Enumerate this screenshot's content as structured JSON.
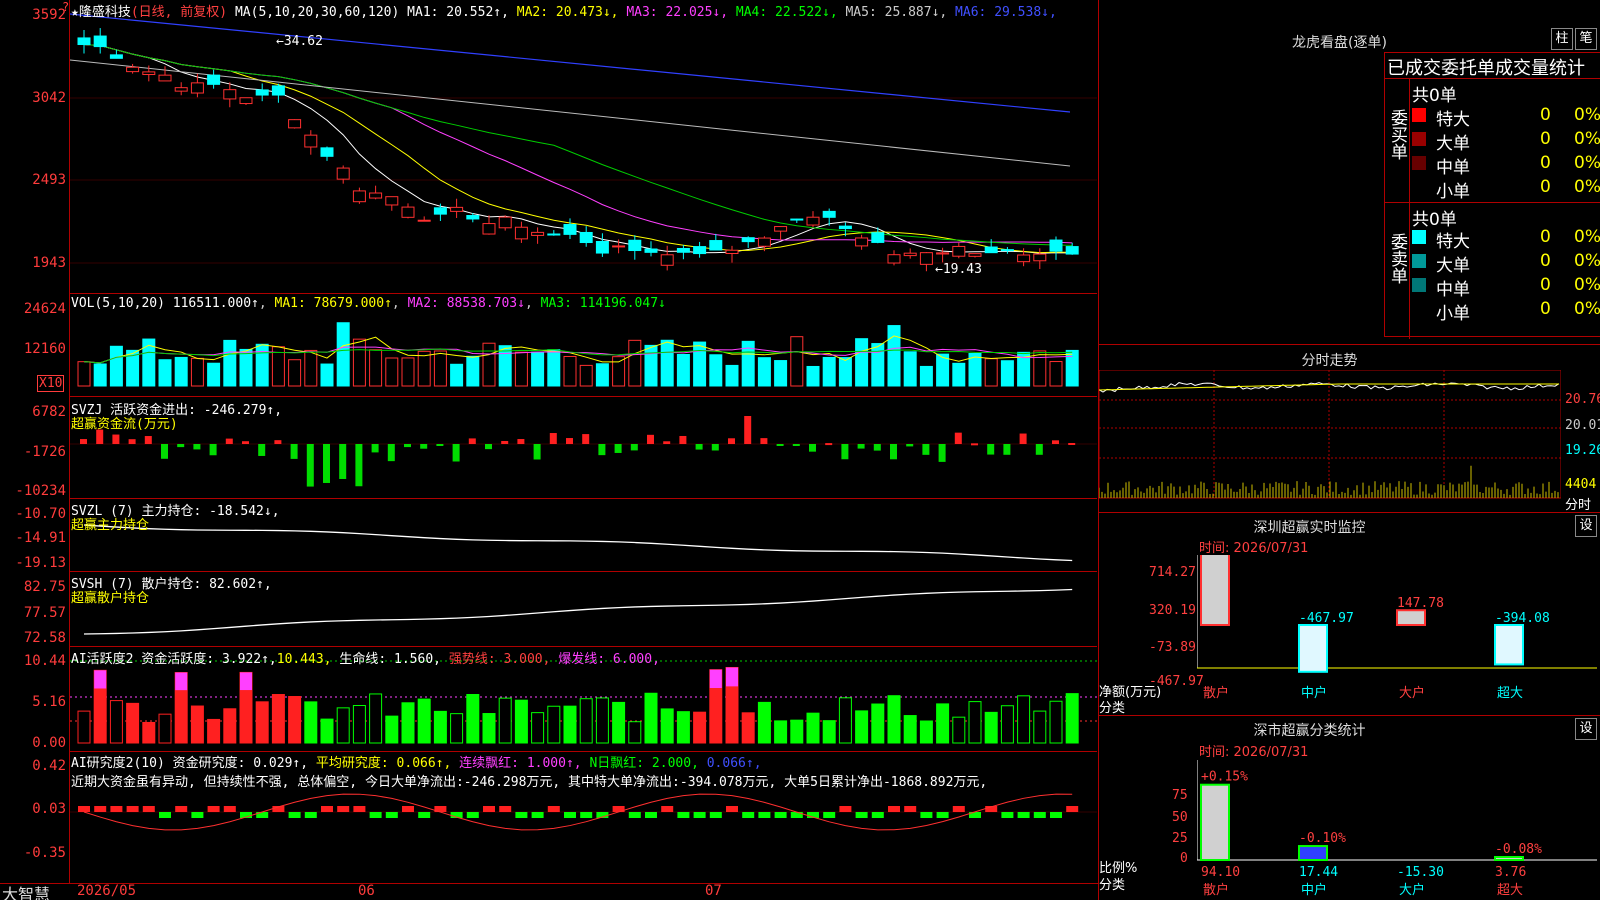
{
  "stock": {
    "name": "★隆盛科技",
    "period": "(日线, 前复权)",
    "ma_label": "MA(5,10,20,30,60,120)",
    "ma": [
      {
        "label": "MA1:",
        "value": "20.552↑",
        "color": "#ffffff"
      },
      {
        "label": "MA2:",
        "value": "20.473↓",
        "color": "#ffff00"
      },
      {
        "label": "MA3:",
        "value": "22.025↓",
        "color": "#ff40ff"
      },
      {
        "label": "MA4:",
        "value": "22.522↓",
        "color": "#00ff00"
      },
      {
        "label": "MA5:",
        "value": "25.887↓",
        "color": "#cccccc"
      },
      {
        "label": "MA6:",
        "value": "29.538↓",
        "color": "#4050ff"
      }
    ],
    "price_axis": [
      "3592",
      "3042",
      "2493",
      "1943"
    ],
    "price_high_note": "←34.62",
    "price_low_note": "←19.43"
  },
  "volume": {
    "label": "VOL(5,10,20)",
    "value": "116511.000↑",
    "ma1": "MA1: 78679.000↑",
    "ma2": "MA2: 88538.703↓",
    "ma3": "MA3: 114196.047↓",
    "axis": [
      "24624",
      "12160"
    ],
    "unit": "X10"
  },
  "svzj": {
    "label": "SVZJ 活跃资金进出: -246.279↑,",
    "sub": "超赢资金流(万元)",
    "axis": [
      "6782",
      "-1726",
      "-10234"
    ]
  },
  "svzl": {
    "label": "SVZL (7) 主力持仓: -18.542↓,",
    "sub": "超赢主力持仓",
    "axis": [
      "-10.70",
      "-14.91",
      "-19.13"
    ]
  },
  "svsh": {
    "label": "SVSH (7) 散户持仓: 82.602↑,",
    "sub": "超赢散户持仓",
    "axis": [
      "82.75",
      "77.57",
      "72.58"
    ]
  },
  "ai_active": {
    "label": "AI活跃度2 资金活跃度: 3.922↑,",
    "v2": "10.443,",
    "v3": "生命线: 1.560,",
    "v4": "强势线: 3.000,",
    "v5": "爆发线: 6.000,",
    "axis": [
      "10.44",
      "5.16",
      "0.00"
    ]
  },
  "ai_research": {
    "label": "AI研究度2(10) 资金研究度: 0.029↑,",
    "avg": "平均研究度: 0.066↑,",
    "streak": "连续飘红: 1.000↑,",
    "nday": "N日飘红: 2.000,",
    "tail": "0.066↑,",
    "comment": "近期大资金虽有异动, 但持续性不强, 总体偏空, 今日大单净流出:-246.298万元, 其中特大单净流出:-394.078万元, 大单5日累计净出-1868.892万元,",
    "axis": [
      "0.42",
      "0.03",
      "-0.35"
    ]
  },
  "bottom": {
    "brand": "大智慧",
    "dates": [
      "2026/05",
      "06",
      "07"
    ]
  },
  "right": {
    "dragon_title": "龙虎看盘(逐单)",
    "btn1": "柱",
    "btn2": "笔",
    "stats_title": "已成交委托单成交量统计",
    "buy_group": "委买单",
    "sell_group": "委卖单",
    "buy_total": "共0单",
    "sell_total": "共0单",
    "rows_buy": [
      {
        "name": "特大",
        "count": "0",
        "pct": "0%",
        "color": "#ff0000"
      },
      {
        "name": "大单",
        "count": "0",
        "pct": "0%",
        "color": "#990000"
      },
      {
        "name": "中单",
        "count": "0",
        "pct": "0%",
        "color": "#660000"
      },
      {
        "name": "小单",
        "count": "0",
        "pct": "0%",
        "color": "#000000"
      }
    ],
    "rows_sell": [
      {
        "name": "特大",
        "count": "0",
        "pct": "0%",
        "color": "#00ffff"
      },
      {
        "name": "大单",
        "count": "0",
        "pct": "0%",
        "color": "#009999"
      },
      {
        "name": "中单",
        "count": "0",
        "pct": "0%",
        "color": "#007777"
      },
      {
        "name": "小单",
        "count": "0",
        "pct": "0%",
        "color": "#000000"
      }
    ],
    "intraday_title": "分时走势",
    "intraday_axis": [
      "20.76",
      "20.01",
      "19.26",
      "4404",
      "分时"
    ],
    "monitor_title": "深圳超赢实时监控",
    "monitor_btn": "设",
    "monitor_time": "时间: 2026/07/31",
    "monitor_axis": [
      "714.27",
      "320.19",
      "-73.89",
      "-467.97"
    ],
    "monitor_ylabel": "净额(万元)",
    "monitor_xlabel": "分类",
    "monitor_bars": [
      {
        "cat": "散户",
        "value": "714.27",
        "v": 714.27
      },
      {
        "cat": "中户",
        "value": "-467.97",
        "v": -467.97
      },
      {
        "cat": "大户",
        "value": "147.78",
        "v": 147.78
      },
      {
        "cat": "超大",
        "value": "-394.08",
        "v": -394.08
      }
    ],
    "class_title": "深市超赢分类统计",
    "class_btn": "设",
    "class_time": "时间: 2026/07/31",
    "class_axis": [
      "75",
      "50",
      "25",
      "0"
    ],
    "class_ylabel": "比例%",
    "class_xlabel": "分类",
    "class_bars": [
      {
        "cat": "散户",
        "top": "+0.15%",
        "bottom": "94.10",
        "v": 94.1
      },
      {
        "cat": "中户",
        "top": "-0.10%",
        "bottom": "17.44",
        "v": 17.44
      },
      {
        "cat": "大户",
        "top": "",
        "bottom": "-15.30",
        "v": 0
      },
      {
        "cat": "超大",
        "top": "-0.08%",
        "bottom": "3.76",
        "v": 3.76
      }
    ]
  }
}
